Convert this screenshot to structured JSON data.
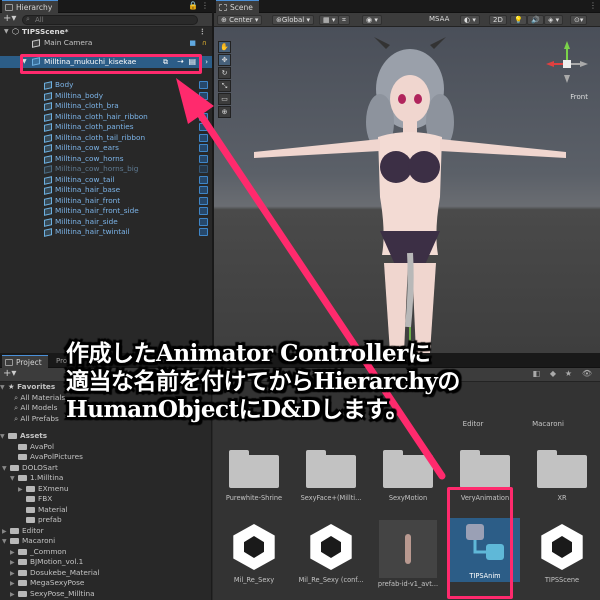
{
  "hierarchy": {
    "tab": "Hierarchy",
    "search_placeholder": "All",
    "scene_name": "TIPSScene*",
    "items": [
      {
        "label": "Main Camera"
      },
      {
        "label": "Milltina_mukuchi_kisekae"
      },
      {
        "label": "Body"
      },
      {
        "label": "Milltina_body"
      },
      {
        "label": "Milltina_cloth_bra"
      },
      {
        "label": "Milltina_cloth_hair_ribbon"
      },
      {
        "label": "Milltina_cloth_panties"
      },
      {
        "label": "Milltina_cloth_tail_ribbon"
      },
      {
        "label": "Milltina_cow_ears"
      },
      {
        "label": "Milltina_cow_horns"
      },
      {
        "label": "Milltina_cow_horns_big"
      },
      {
        "label": "Milltina_cow_tail"
      },
      {
        "label": "Milltina_hair_base"
      },
      {
        "label": "Milltina_hair_front"
      },
      {
        "label": "Milltina_hair_front_side"
      },
      {
        "label": "Milltina_hair_side"
      },
      {
        "label": "Milltina_hair_twintail"
      }
    ]
  },
  "scene": {
    "tab": "Scene",
    "pivot": "Center",
    "space": "Global",
    "msaa": "MSAA",
    "mode_2d": "2D",
    "gizmo_view": "Front"
  },
  "project": {
    "tab": "Project",
    "tab2": "Proje",
    "tab3": "Ani",
    "tab4": "Anim",
    "favorites_title": "Favorites",
    "favorites": [
      "All Materials",
      "All Models",
      "All Prefabs"
    ],
    "assets_title": "Assets",
    "tree": [
      {
        "label": "AvaPol",
        "indent": 1
      },
      {
        "label": "AvaPolPictures",
        "indent": 1
      },
      {
        "label": "DOLOSart",
        "indent": 1
      },
      {
        "label": "1.Milltina",
        "indent": 2
      },
      {
        "label": "EXmenu",
        "indent": 3
      },
      {
        "label": "FBX",
        "indent": 3
      },
      {
        "label": "Material",
        "indent": 3
      },
      {
        "label": "prefab",
        "indent": 3
      },
      {
        "label": "Editor",
        "indent": 1
      },
      {
        "label": "Macaroni",
        "indent": 1
      },
      {
        "label": "_Common",
        "indent": 2
      },
      {
        "label": "BJMotion_vol.1",
        "indent": 2
      },
      {
        "label": "Dosukebe_Material",
        "indent": 2
      },
      {
        "label": "MegaSexyPose",
        "indent": 2
      },
      {
        "label": "SexyPose_Milltina",
        "indent": 2
      }
    ],
    "grid_top": [
      "Editor",
      "Macaroni"
    ],
    "grid_row1": [
      "Purewhite-Shrine",
      "SexyFace+(Millti...",
      "SexyMotion",
      "VeryAnimation",
      "XR"
    ],
    "grid_row2": [
      "Mil_Re_Sexy",
      "Mil_Re_Sexy (conf...",
      "prefab-id-v1_avt...",
      "TIPSAnim",
      "TIPSScene"
    ]
  },
  "caption": {
    "line1": "作成したAnimator Controllerに",
    "line2": "適当な名前を付けてからHierarchyの",
    "line3": "HumanObjectにD&Dします。"
  },
  "colors": {
    "highlight": "#ff2a6d",
    "selection_blue": "#2c5d87",
    "prefab_text": "#7cb4e8"
  }
}
